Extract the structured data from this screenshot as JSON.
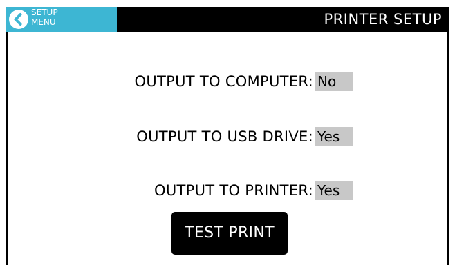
{
  "header": {
    "back_label": "SETUP\nMENU",
    "title": "PRINTER SETUP",
    "back_icon": "chevron-left-icon"
  },
  "settings": [
    {
      "label": "OUTPUT TO COMPUTER:",
      "value": "No"
    },
    {
      "label": "OUTPUT TO USB DRIVE:",
      "value": "Yes"
    },
    {
      "label": "OUTPUT TO PRINTER:",
      "value": "Yes"
    }
  ],
  "actions": {
    "test_print_label": "TEST PRINT"
  },
  "colors": {
    "header_bg": "#000000",
    "back_button_bg": "#3db6d3",
    "value_bg": "#c8c8c8",
    "button_bg": "#000000"
  }
}
